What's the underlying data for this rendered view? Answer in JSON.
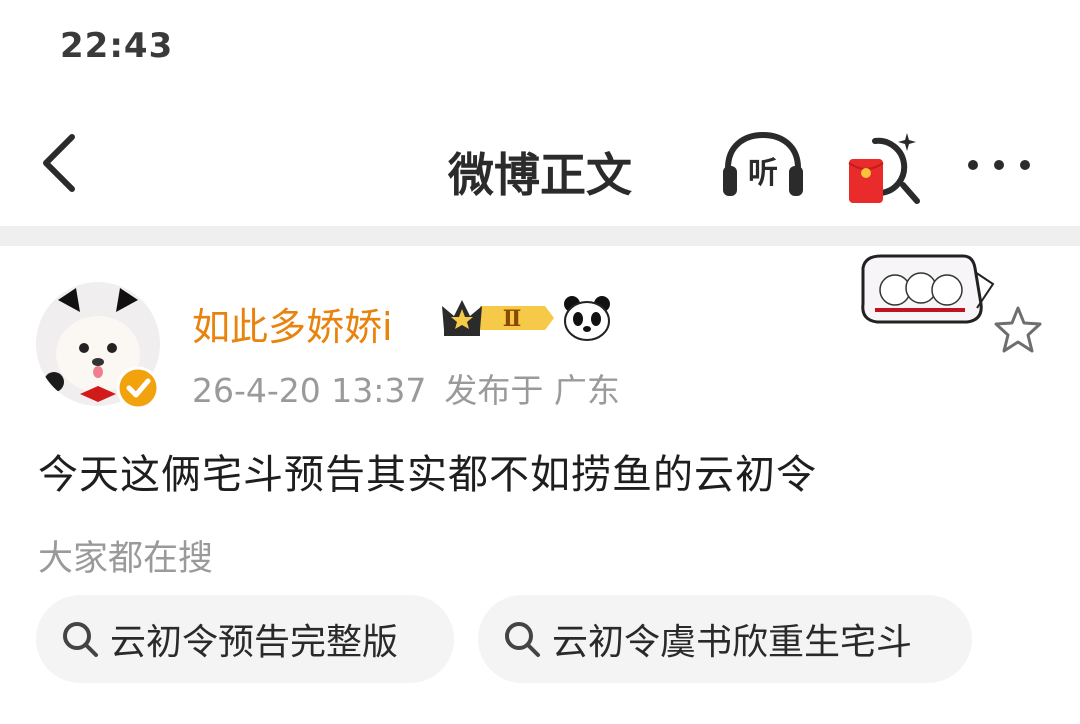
{
  "status_bar": {
    "time": "22:43"
  },
  "nav": {
    "title": "微博正文",
    "listen_label": "听",
    "back_icon": "chevron-left-icon",
    "more_icon": "more-horizontal-icon"
  },
  "post": {
    "author": {
      "name": "如此多娇娇i",
      "level": "Ⅱ"
    },
    "timestamp": "26-4-20 13:37",
    "location": "发布于 广东",
    "text": "今天这俩宅斗预告其实都不如捞鱼的云初令"
  },
  "related_search": {
    "heading": "大家都在搜",
    "chips": [
      {
        "label": "云初令预告完整版"
      },
      {
        "label": "云初令虞书欣重生宅斗"
      }
    ]
  },
  "colors": {
    "username": "#e8830e",
    "divider": "#efefef",
    "chip_bg": "#f4f4f4",
    "verify_gold": "#f2a20c"
  }
}
